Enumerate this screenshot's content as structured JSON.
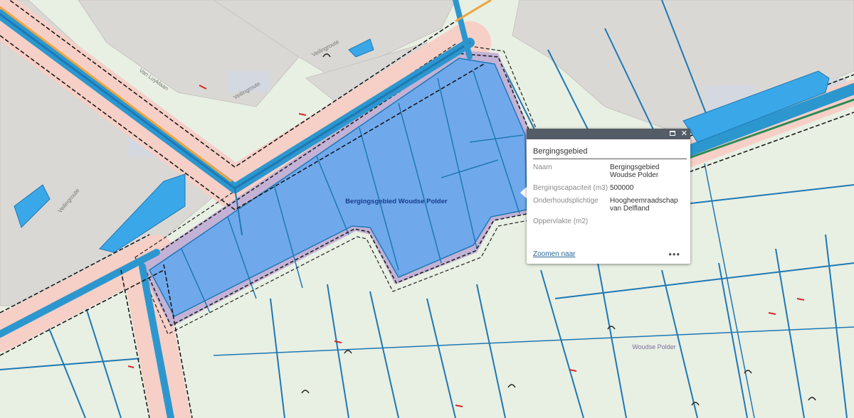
{
  "map": {
    "feature_label": "Bergingsgebied Woudse Polder",
    "polder_label": "Woudse Polder",
    "street_labels": [
      "Veilingroute",
      "Veilingroute",
      "Veilingroute",
      "Van Luyklaan"
    ],
    "colors": {
      "background": "#e8efe3",
      "urban": "#dad8d5",
      "water": "#1e78b4",
      "water_fill": "#3aa8e8",
      "storage_area": "#6fa9ec",
      "dike_pink": "#f6cfc6",
      "dike_purple": "#c3b2d6"
    }
  },
  "popup": {
    "title": "Bergingsgebied",
    "fields": [
      {
        "key": "Naam",
        "value": "Bergingsgebied Woudse Polder"
      },
      {
        "key": "Bergingscapaciteit (m3)",
        "value": "500000"
      },
      {
        "key": "Onderhoudsplichtige",
        "value": "Hoogheemraadschap van Delfland"
      },
      {
        "key": "Oppervlakte (m2)",
        "value": ""
      }
    ],
    "zoom_label": "Zoomen naar",
    "more_label": "•••",
    "maximize_icon": "maximize-icon",
    "close_icon": "close-icon",
    "close_glyph": "✕"
  }
}
